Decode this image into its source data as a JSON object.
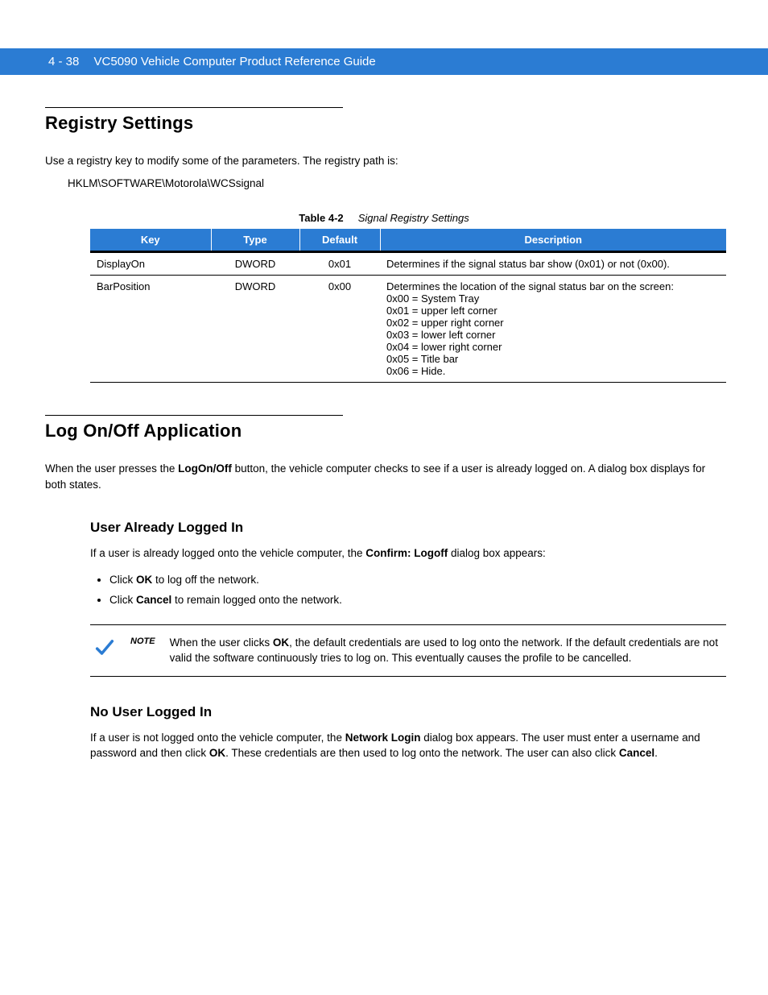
{
  "header": {
    "page_ref": "4 - 38",
    "doc_title": "VC5090 Vehicle Computer Product Reference Guide"
  },
  "section1": {
    "title": "Registry Settings",
    "intro": "Use a registry key to modify some of the parameters. The registry path is:",
    "registry_path": "HKLM\\SOFTWARE\\Motorola\\WCSsignal",
    "table_label": "Table 4-2",
    "table_caption": "Signal Registry Settings",
    "columns": [
      "Key",
      "Type",
      "Default",
      "Description"
    ],
    "rows": [
      {
        "key": "DisplayOn",
        "type": "DWORD",
        "default": "0x01",
        "desc": "Determines if the signal status bar show (0x01) or not (0x00)."
      },
      {
        "key": "BarPosition",
        "type": "DWORD",
        "default": "0x00",
        "desc_lines": [
          "Determines the location of the signal status bar on the screen:",
          "0x00 = System Tray",
          "0x01 = upper left corner",
          "0x02 = upper right corner",
          "0x03 = lower left corner",
          "0x04 = lower right corner",
          "0x05 = Title bar",
          "0x06 = Hide."
        ]
      }
    ]
  },
  "section2": {
    "title": "Log On/Off Application",
    "para1_a": "When the user presses the ",
    "para1_b": "LogOn/Off",
    "para1_c": " button, the vehicle computer checks to see if a user is already logged on. A dialog box displays for both states.",
    "sub1": {
      "title": "User Already Logged In",
      "para_a": "If a user is already logged onto the vehicle computer, the ",
      "para_b": "Confirm: Logoff",
      "para_c": " dialog box appears:",
      "bullets": [
        {
          "a": "Click ",
          "b": "OK",
          "c": " to log off the network."
        },
        {
          "a": "Click ",
          "b": "Cancel",
          "c": " to remain logged onto the network."
        }
      ],
      "note_label": "NOTE",
      "note_a": "When the user clicks ",
      "note_b": "OK",
      "note_c": ", the default credentials are used to log onto the network. If the default credentials are not valid the software continuously tries to log on. This eventually causes the profile to be cancelled."
    },
    "sub2": {
      "title": "No User Logged In",
      "para_a": "If a user is not logged onto the vehicle computer, the ",
      "para_b": "Network Login",
      "para_c": " dialog box appears. The user must enter a username and password and then click ",
      "para_d": "OK",
      "para_e": ". These credentials are then used to log onto the network. The user can also click ",
      "para_f": "Cancel",
      "para_g": "."
    }
  }
}
